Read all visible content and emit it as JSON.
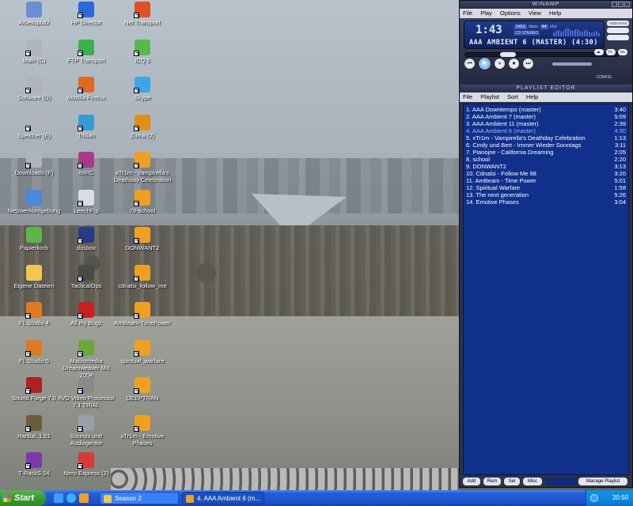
{
  "desktop_icons": [
    {
      "label": "Arbeitsplatz",
      "icon": "computer-icon",
      "color": "#6a8fd0",
      "shortcut": false
    },
    {
      "label": "Main (C)",
      "icon": "drive-icon",
      "color": "#b0b4ba",
      "shortcut": true
    },
    {
      "label": "Software (D)",
      "icon": "drive-icon",
      "color": "#b0b4ba",
      "shortcut": true
    },
    {
      "label": "Speicher (E)",
      "icon": "drive-icon",
      "color": "#b0b4ba",
      "shortcut": true
    },
    {
      "label": "Downloads (F)",
      "icon": "drive-icon",
      "color": "#b0b4ba",
      "shortcut": true
    },
    {
      "label": "Netzwerkumgebung",
      "icon": "network-icon",
      "color": "#4a88d8",
      "shortcut": false
    },
    {
      "label": "Papierkorb",
      "icon": "recycle-bin-icon",
      "color": "#58b84c",
      "shortcut": false
    },
    {
      "label": "Eigene Dateien",
      "icon": "folder-icon",
      "color": "#f0c850",
      "shortcut": false
    },
    {
      "label": "FL Studio 4",
      "icon": "fl-studio-icon",
      "color": "#e07a20",
      "shortcut": true
    },
    {
      "label": "FL Studio 5",
      "icon": "fl-studio-icon",
      "color": "#e07a20",
      "shortcut": true
    },
    {
      "label": "Sound Forge 7.0",
      "icon": "sound-forge-icon",
      "color": "#b02020",
      "shortcut": true
    },
    {
      "label": "HarBal, 1.51",
      "icon": "harbal-icon",
      "color": "#6a5c3a",
      "shortcut": true
    },
    {
      "label": "T-RackS 24",
      "icon": "t-racks-icon",
      "color": "#7a3aa8",
      "shortcut": true
    },
    {
      "label": "HP Director",
      "icon": "hp-director-icon",
      "color": "#2a6ad8",
      "shortcut": true
    },
    {
      "label": "FTP Transport",
      "icon": "ftp-icon",
      "color": "#3cb04a",
      "shortcut": true
    },
    {
      "label": "Mozilla Firefox",
      "icon": "firefox-icon",
      "color": "#e06a20",
      "shortcut": true
    },
    {
      "label": "Trillian",
      "icon": "trillian-icon",
      "color": "#3a9ad8",
      "shortcut": true
    },
    {
      "label": "mIRC",
      "icon": "mirc-icon",
      "color": "#a83a8a",
      "shortcut": true
    },
    {
      "label": "LeechFtp",
      "icon": "leechftp-icon",
      "color": "#d8dce4",
      "shortcut": true
    },
    {
      "label": "dosbox",
      "icon": "dosbox-icon",
      "color": "#2a3a8a",
      "shortcut": true
    },
    {
      "label": "TacticalOps",
      "icon": "tacticalops-icon",
      "color": "#4a4a40",
      "shortcut": true
    },
    {
      "label": "All my Bugz",
      "icon": "bug-icon",
      "color": "#c82020",
      "shortcut": true
    },
    {
      "label": "Macromedia Dreamweaver MX 2004",
      "icon": "dreamweaver-icon",
      "color": "#6aa83a",
      "shortcut": true
    },
    {
      "label": "AVD Video Processor 7.1 TRIAL",
      "icon": "avd-icon",
      "color": "#8a8a8a",
      "shortcut": true
    },
    {
      "label": "Sounds und Audiogeräte",
      "icon": "speaker-icon",
      "color": "#9aa0a8",
      "shortcut": true
    },
    {
      "label": "Nero Express (2)",
      "icon": "nero-icon",
      "color": "#d83a3a",
      "shortcut": true
    },
    {
      "label": "Net Transport",
      "icon": "net-transport-icon",
      "color": "#e05020",
      "shortcut": true
    },
    {
      "label": "ICQ 5",
      "icon": "icq-icon",
      "color": "#58b84c",
      "shortcut": true
    },
    {
      "label": "Skype",
      "icon": "skype-icon",
      "color": "#3aa8e8",
      "shortcut": true
    },
    {
      "label": "Zuma (2)",
      "icon": "zuma-icon",
      "color": "#e0901a",
      "shortcut": true
    },
    {
      "label": "xTr1m - Vampirella's Deathday Celebration",
      "icon": "winamp-file-icon",
      "color": "#f0a020",
      "shortcut": true
    },
    {
      "label": "79-school",
      "icon": "winamp-file-icon",
      "color": "#f0a020",
      "shortcut": true
    },
    {
      "label": "DONWANT2",
      "icon": "winamp-file-icon",
      "color": "#f0a020",
      "shortcut": true
    },
    {
      "label": "cdnalsi_follow_me",
      "icon": "winamp-file-icon",
      "color": "#f0a020",
      "shortcut": true
    },
    {
      "label": "AmBeam-TimePower",
      "icon": "winamp-file-icon",
      "color": "#f0a020",
      "shortcut": true
    },
    {
      "label": "spiritual_warfare",
      "icon": "winamp-file-icon",
      "color": "#f0a020",
      "shortcut": true
    },
    {
      "label": "DEEPTRAN",
      "icon": "winamp-file-icon",
      "color": "#f0a020",
      "shortcut": true
    },
    {
      "label": "xTr1m - Emotive Phases",
      "icon": "winamp-file-icon",
      "color": "#f0a020",
      "shortcut": true
    }
  ],
  "winamp": {
    "title": "WINAMP",
    "menu": [
      "File",
      "Play",
      "Options",
      "View",
      "Help"
    ],
    "time": "1:43",
    "kbps": "1411",
    "khz": "44",
    "cd_stereo": "CD STEREO",
    "marquee": "AAA AMBIENT 6 (MASTER) (4:30)",
    "side_buttons": [
      "VIDEO/VIS",
      "",
      ""
    ],
    "shuffle_buttons": [
      "⏏",
      "PL",
      "ML"
    ],
    "config_label": "CONFIG",
    "seek_progress": 0.25
  },
  "playlist": {
    "title": "PLAYLIST EDITOR",
    "menu": [
      "File",
      "Playlist",
      "Sort",
      "Help"
    ],
    "current_index": 3,
    "items": [
      {
        "title": "1. AAA Downtempo (master)",
        "time": "3:40"
      },
      {
        "title": "2. AAA Ambient 7 (master)",
        "time": "5:09"
      },
      {
        "title": "3. AAA Ambient 11 (master)",
        "time": "2:39"
      },
      {
        "title": "4. AAA Ambient 6 (master)",
        "time": "4:30"
      },
      {
        "title": "5. xTr1m - Vampirella's Deathday Celebration",
        "time": "1:13"
      },
      {
        "title": "6. Cindy und Bert - Immer Wieder Sonntags",
        "time": "3:11"
      },
      {
        "title": "7. Pianojoe - California Dreaming",
        "time": "2:05"
      },
      {
        "title": "8. school",
        "time": "2:20"
      },
      {
        "title": "9. DONWANT2",
        "time": "3:13"
      },
      {
        "title": "10. Cdnalsi - Follow Me 98",
        "time": "3:20"
      },
      {
        "title": "11. AmBeam - Time Power",
        "time": "5:01"
      },
      {
        "title": "12. Spiritual Warfare",
        "time": "1:58"
      },
      {
        "title": "13. The next generation",
        "time": "5:26"
      },
      {
        "title": "14. Emotive Phases",
        "time": "3:04"
      }
    ],
    "buttons": {
      "add": "Add",
      "rem": "Rem",
      "sel": "Sel",
      "misc": "Misc",
      "manage": "Manage Playlist"
    }
  },
  "taskbar": {
    "start_label": "Start",
    "tasks": [
      {
        "label": "Season 2",
        "icon": "folder-icon"
      },
      {
        "label": "4. AAA Ambient 6 (m...",
        "icon": "winamp-icon"
      }
    ],
    "clock": "20:50"
  }
}
